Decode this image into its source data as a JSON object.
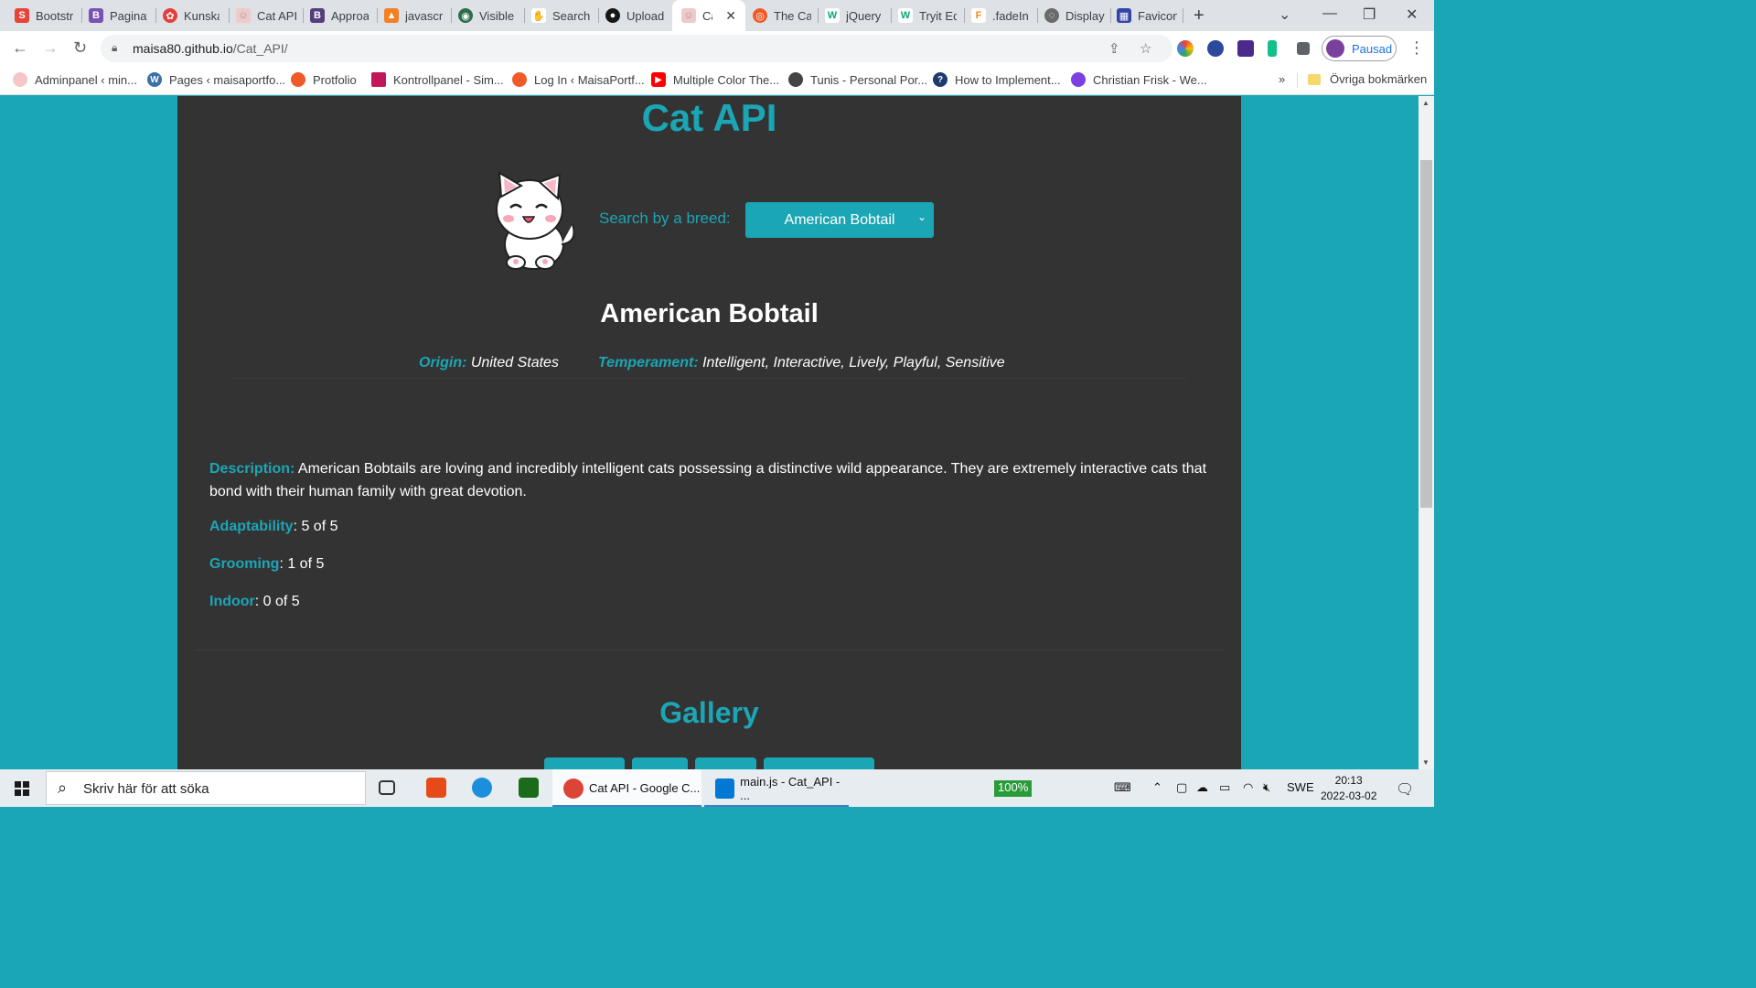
{
  "browser": {
    "tabs": [
      {
        "label": "Bootstr",
        "icon": "S",
        "color": "#e8443a"
      },
      {
        "label": "Paginat",
        "icon": "B",
        "color": "#7952b3"
      },
      {
        "label": "Kunska",
        "icon": "✿",
        "color": "#e2403c"
      },
      {
        "label": "Cat API",
        "icon": "☺",
        "color": "#f0c9c9"
      },
      {
        "label": "Approa",
        "icon": "B",
        "color": "#563d7c"
      },
      {
        "label": "javascr",
        "icon": "▲",
        "color": "#f48024"
      },
      {
        "label": "Visible",
        "icon": "◉",
        "color": "#2c6e49"
      },
      {
        "label": "Search",
        "icon": "✋",
        "color": "#222222"
      },
      {
        "label": "Upload",
        "icon": "●",
        "color": "#181717"
      },
      {
        "label": "Cat",
        "icon": "☺",
        "color": "#f0c9c9"
      },
      {
        "label": "The Ca",
        "icon": "◎",
        "color": "#f05a28"
      },
      {
        "label": "jQuery",
        "icon": "W",
        "color": "#04aa6d"
      },
      {
        "label": "Tryit Ed",
        "icon": "W",
        "color": "#04aa6d"
      },
      {
        "label": ".fadeIn",
        "icon": "F",
        "color": "#f28b1b"
      },
      {
        "label": "Display",
        "icon": "◌",
        "color": "#6a6a6a"
      },
      {
        "label": "Favicon",
        "icon": "▦",
        "color": "#3346a8"
      }
    ],
    "url_host": "maisa80.github.io",
    "url_path": "/Cat_API/",
    "profile_label": "Pausad",
    "bookmarks": [
      {
        "label": "Adminpanel ‹ min...",
        "color": "#f7c6c6"
      },
      {
        "label": "Pages ‹ maisaportfo...",
        "color": "#3a6fa8"
      },
      {
        "label": "Protfolio",
        "color": "#f05a28"
      },
      {
        "label": "Kontrollpanel - Sim...",
        "color": "#c2185b"
      },
      {
        "label": "Log In ‹ MaisaPortf...",
        "color": "#f05a28"
      },
      {
        "label": "Multiple Color The...",
        "color": "#ff0000"
      },
      {
        "label": "Tunis - Personal Por...",
        "color": "#444444"
      },
      {
        "label": "How to Implement...",
        "color": "#1e3a6e"
      },
      {
        "label": "Christian Frisk - We...",
        "color": "#7b3fe4"
      }
    ],
    "bookmarks_more": "»",
    "other_bookmarks": "Övriga bokmärken"
  },
  "page": {
    "title": "Cat API",
    "search_label": "Search by a breed:",
    "selected_breed": "American Bobtail",
    "breed_name": "American Bobtail",
    "origin_label": "Origin:",
    "origin_value": "United States",
    "temperament_label": "Temperament:",
    "temperament_value": "Intelligent, Interactive, Lively, Playful, Sensitive",
    "description_label": "Description:",
    "description_value": "American Bobtails are loving and incredibly intelligent cats possessing a distinctive wild appearance. They are extremely interactive cats that bond with their human family with great devotion.",
    "adaptability_label": "Adaptability",
    "adaptability_value": ": 5 of 5",
    "grooming_label": "Grooming",
    "grooming_value": ": 1 of 5",
    "indoor_label": "Indoor",
    "indoor_value": ": 0 of 5",
    "gallery_title": "Gallery"
  },
  "taskbar": {
    "search_placeholder": "Skriv här för att söka",
    "apps": [
      {
        "label": "Cat API - Google C...",
        "color": "#db4437"
      },
      {
        "label": "main.js - Cat_API - ...",
        "color": "#0078d4"
      }
    ],
    "zoom": "100%",
    "language": "SWE",
    "time": "20:13",
    "date": "2022-03-02"
  },
  "colors": {
    "accent": "#1ba6b5",
    "panel": "#333333"
  }
}
